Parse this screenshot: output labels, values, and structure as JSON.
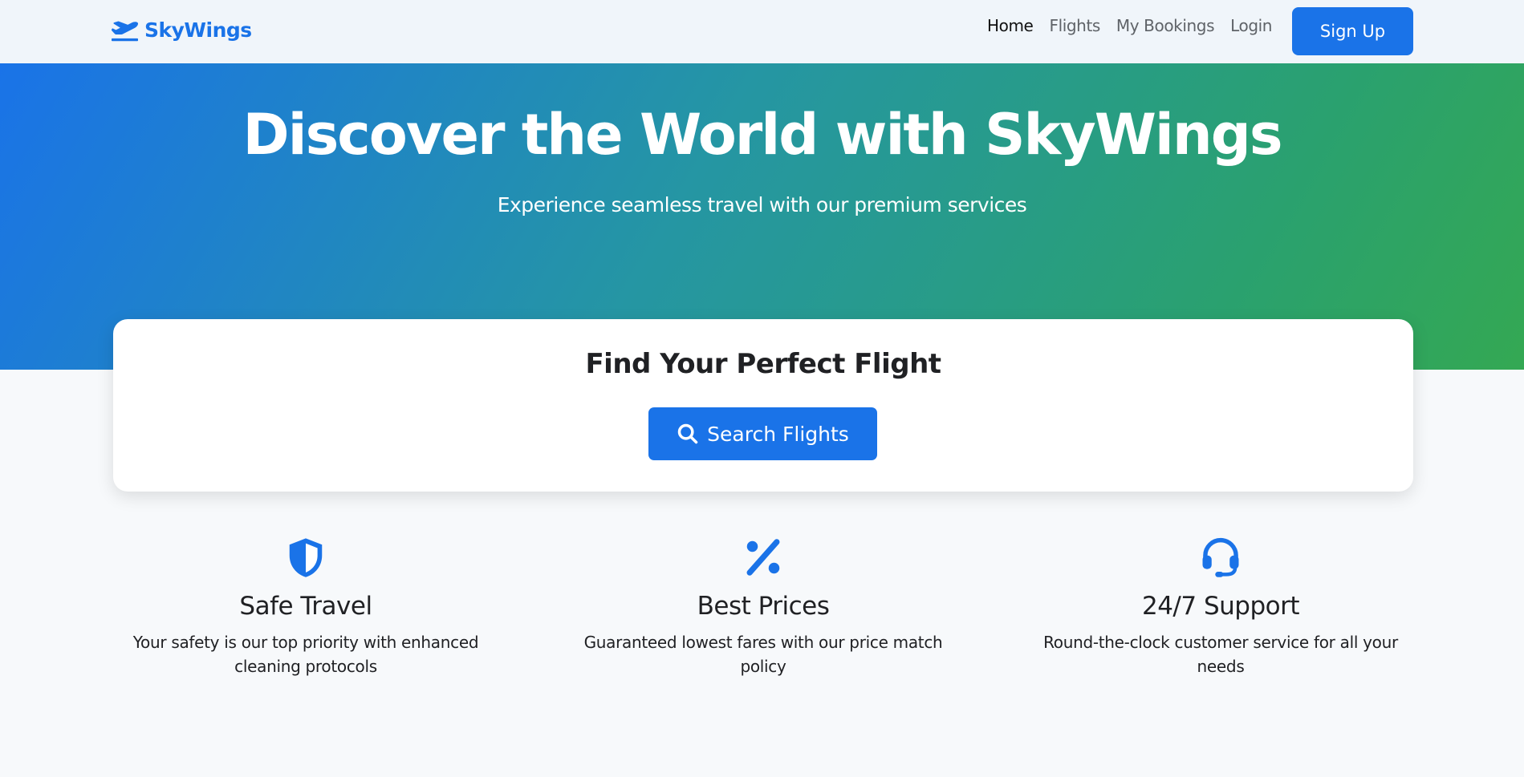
{
  "navbar": {
    "brand": "SkyWings",
    "brand_icon": "plane-departure-icon",
    "links": [
      {
        "label": "Home",
        "active": true
      },
      {
        "label": "Flights",
        "active": false
      },
      {
        "label": "My Bookings",
        "active": false
      },
      {
        "label": "Login",
        "active": false
      }
    ],
    "signup_label": "Sign Up"
  },
  "hero": {
    "title": "Discover the World with SkyWings",
    "subtitle": "Experience seamless travel with our premium services"
  },
  "search": {
    "title": "Find Your Perfect Flight",
    "button_label": "Search Flights",
    "button_icon": "search-icon"
  },
  "features": [
    {
      "icon": "shield-icon",
      "title": "Safe Travel",
      "description": "Your safety is our top priority with enhanced cleaning protocols"
    },
    {
      "icon": "percent-icon",
      "title": "Best Prices",
      "description": "Guaranteed lowest fares with our price match policy"
    },
    {
      "icon": "headset-icon",
      "title": "24/7 Support",
      "description": "Round-the-clock customer service for all your needs"
    }
  ],
  "colors": {
    "primary": "#1a73e8",
    "hero_gradient_start": "#1a73e8",
    "hero_gradient_end": "#34a853",
    "navbar_bg": "#f0f5fa",
    "page_bg": "#f7f9fb"
  }
}
